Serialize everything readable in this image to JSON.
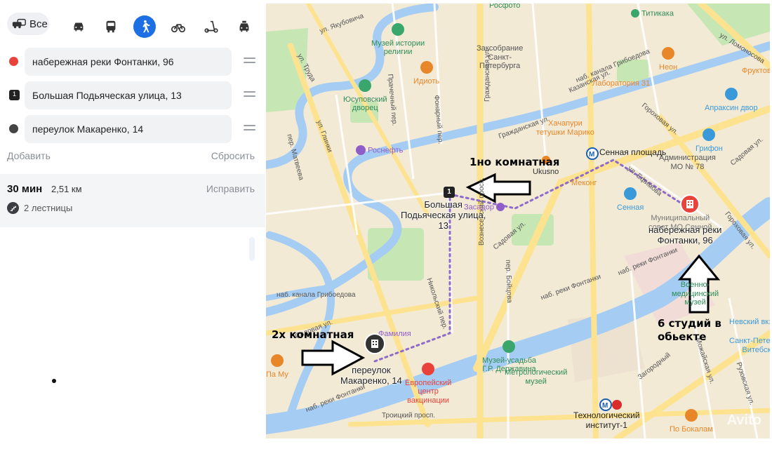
{
  "transport_modes": {
    "all_label": "Все",
    "items": [
      "car",
      "bus",
      "pedestrian",
      "bicycle",
      "scooter",
      "taxi"
    ],
    "active": "pedestrian"
  },
  "route_points": [
    {
      "marker": "",
      "value": "набережная реки Фонтанки, 96",
      "color": "#e8423a"
    },
    {
      "marker": "1",
      "value": "Большая Подьяческая улица, 13",
      "color": "#222222"
    },
    {
      "marker": "",
      "value": "переулок Макаренко, 14",
      "color": "#444444"
    }
  ],
  "actions": {
    "add": "Добавить",
    "reset": "Сбросить"
  },
  "route_summary": {
    "time": "30 мин",
    "distance": "2,51 км",
    "fix": "Исправить",
    "stairs": "2 лестницы"
  },
  "map": {
    "streets": {
      "truda": "ул. Труда",
      "yakubovicha": "ул. Якубовича",
      "glinki": "ул. Глинки",
      "matveeva": "пер. Матвеева",
      "pracheshny": "Прачечный пер.",
      "fonarny": "Фонарный пер.",
      "voznesensky": "Вознесенский просп.",
      "grazhdanskaya": "Гражданская ул.",
      "kazanskaya": "Казанская ул.",
      "griboedova_top": "наб. канала Грибоедова",
      "griboedova_left": "наб. канала Грибоедова",
      "sadovaya": "Садовая ул.",
      "sadovaya_left": "Садовая ул.",
      "fontanka_mid": "наб. реки Фонтанки",
      "fontanka_right": "наб. реки Фонтанки",
      "fontanka_bottom": "наб. реки Фонтанки",
      "nikolsky": "Никольский пер.",
      "boitsova": "пер. Бойцова",
      "lomonosova": "ул. Ломоносова",
      "gorokhovaya": "Гороховая ул.",
      "gorokhovaya2": "Гороховая ул.",
      "efimova": "ул. Ефимова",
      "zagorodny": "Загородный",
      "mozhayskaya": "Можайская ул.",
      "ruzovskaya": "Рузовская ул.",
      "troitsky": "Троицкий просп.",
      "dekabristov": "ул. Декабристов",
      "sadovaya_right": "Садовая ул."
    },
    "pois": [
      {
        "name": "Росфото",
        "color": "#2e8b57"
      },
      {
        "name": "Музей истории\nрелигии",
        "color": "#3aa66b"
      },
      {
        "name": "Заксобрание\nСанкт-\nПетербурга",
        "color": "#777"
      },
      {
        "name": "Титикака",
        "color": "#3aa66b"
      },
      {
        "name": "Идиоть",
        "color": "#e8872a"
      },
      {
        "name": "Юсуповский\nдворец",
        "color": "#3aa66b"
      },
      {
        "name": "Лаборатория 31",
        "color": "#e8872a"
      },
      {
        "name": "Неон",
        "color": "#e8872a"
      },
      {
        "name": "Апраксин двор",
        "color": "#3a9ad9"
      },
      {
        "name": "Фруктовая",
        "color": "#e8872a"
      },
      {
        "name": "Хачапури\nтетушки Марико",
        "color": "#e8872a"
      },
      {
        "name": "Роснефть",
        "color": "#8e5dc8"
      },
      {
        "name": "Ukusno",
        "color": "#e8872a"
      },
      {
        "name": "Меконг",
        "color": "#e8872a"
      },
      {
        "name": "Грифон",
        "color": "#3a9ad9"
      },
      {
        "name": "Администрация\nМО № 78",
        "color": "#777"
      },
      {
        "name": "Сенная",
        "color": "#3a9ad9"
      },
      {
        "name": "Муниципальный\nсовет МО Сенной",
        "color": "#777"
      },
      {
        "name": "Военно-\nмедицинский\nмузей",
        "color": "#3aa66b"
      },
      {
        "name": "Музей-усадьба\nГ.Р. Державина",
        "color": "#3aa66b"
      },
      {
        "name": "Метрологический\nмузей",
        "color": "#3aa66b"
      },
      {
        "name": "Европейский\nцентр\nвакцинации",
        "color": "#e8423a"
      },
      {
        "name": "Па Му",
        "color": "#e8872a"
      },
      {
        "name": "Фамилия",
        "color": "#8e5dc8"
      },
      {
        "name": "По Бокалам",
        "color": "#e8872a"
      },
      {
        "name": "Санкт-Петербург-\nВитебский",
        "color": "#3a9ad9"
      },
      {
        "name": "Невский вкз",
        "color": "#3a9ad9"
      },
      {
        "name": "Засадор",
        "color": "#8e5dc8"
      }
    ],
    "metro": [
      {
        "name": "Сенная площадь",
        "letter": "M"
      },
      {
        "name": "Технологический\nинститут-1",
        "letter": "M",
        "line": "1"
      }
    ],
    "markers": {
      "stop1": "1",
      "dest_addr": "набережная реки\nФонтанки, 96",
      "stop1_addr": "Большая\nПодьяческая улица,\n13",
      "start_addr": "переулок\nМакаренко, 14"
    },
    "annotations": {
      "one_room": "1но комнатная",
      "two_room": "2х комнатная",
      "studios": "6 студий в\nобьекте"
    },
    "watermark": "Avito",
    "colors": {
      "water": "#a5cdf3",
      "park": "#c6e6b4",
      "road": "#fde38f",
      "block": "#efe6d4",
      "route": "#8e6bc9"
    }
  }
}
